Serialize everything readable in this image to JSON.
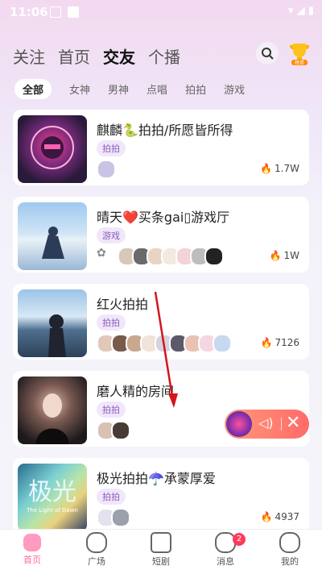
{
  "status": {
    "time": "11:06"
  },
  "top_tabs": [
    "关注",
    "首页",
    "交友",
    "个播"
  ],
  "active_top_tab": "交友",
  "chips": [
    "全部",
    "女神",
    "男神",
    "点唱",
    "拍拍",
    "游戏"
  ],
  "active_chip": "全部",
  "trophy_label": "榜单",
  "rooms": [
    {
      "title": "麒麟🐍拍拍/所愿皆所得",
      "tag": "拍拍",
      "heat": "1.7W"
    },
    {
      "title": "晴天❤️买条gai▯游戏厅",
      "tag": "游戏",
      "heat": "1W"
    },
    {
      "title": "红火拍拍",
      "tag": "拍拍",
      "heat": "7126"
    },
    {
      "title": "磨人精的房间",
      "tag": "拍拍",
      "heat": ""
    },
    {
      "title": "极光拍拍☂️承蒙厚爱",
      "tag": "拍拍",
      "heat": "4937"
    }
  ],
  "aurora_thumb_text": "极光",
  "aurora_thumb_sub": "The Light of Dawn",
  "bottom_nav": [
    {
      "label": "首页"
    },
    {
      "label": "广场"
    },
    {
      "label": "短剧"
    },
    {
      "label": "消息",
      "badge": "2"
    },
    {
      "label": "我的"
    }
  ],
  "colors": {
    "accent": "#ff6a6a",
    "tag_text": "#8a5bb9",
    "heat_flame": "#ff8a2a"
  }
}
